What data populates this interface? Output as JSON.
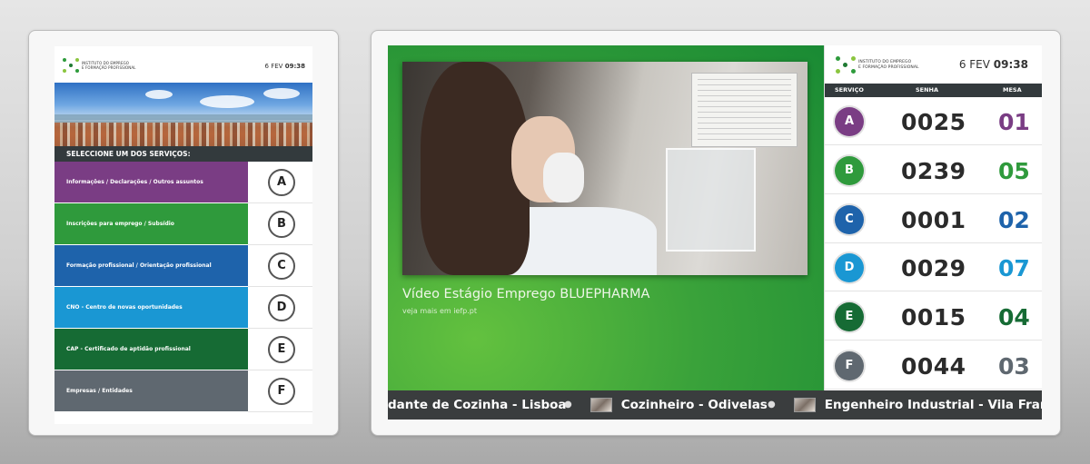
{
  "brand": {
    "logo_text": "Instituto do Emprego\ne Formação Profissional",
    "logo_colors": [
      "#2e9b3c",
      "#8bc53f",
      "#1f7a33"
    ]
  },
  "kiosk": {
    "date": "6 FEV",
    "time": "09:38",
    "prompt": "SELECCIONE UM DOS SERVIÇOS:",
    "services": [
      {
        "label": "Informações / Declarações / Outros assuntos",
        "letter": "A",
        "color": "#7a3d84"
      },
      {
        "label": "Inscrições para emprego / Subsídio",
        "letter": "B",
        "color": "#2f9a3c"
      },
      {
        "label": "Formação profissional / Orientação profissional",
        "letter": "C",
        "color": "#1e63ab"
      },
      {
        "label": "CNO - Centro de novas oportunidades",
        "letter": "D",
        "color": "#1a97d3"
      },
      {
        "label": "CAP - Certificado de aptidão profissional",
        "letter": "E",
        "color": "#166b34"
      },
      {
        "label": "Empresas / Entidades",
        "letter": "F",
        "color": "#5f6870"
      }
    ]
  },
  "display": {
    "video_title": "Vídeo Estágio Emprego BLUEPHARMA",
    "video_subtitle": "veja mais em iefp.pt",
    "date": "6 FEV",
    "time": "09:38",
    "columns": {
      "service": "SERVIÇO",
      "ticket": "SENHA",
      "desk": "MESA"
    },
    "queue": [
      {
        "service": "A",
        "ticket": "0025",
        "desk": "01",
        "color": "#7a3d84"
      },
      {
        "service": "B",
        "ticket": "0239",
        "desk": "05",
        "color": "#2f9a3c"
      },
      {
        "service": "C",
        "ticket": "0001",
        "desk": "02",
        "color": "#1e63ab"
      },
      {
        "service": "D",
        "ticket": "0029",
        "desk": "07",
        "color": "#1a97d3"
      },
      {
        "service": "E",
        "ticket": "0015",
        "desk": "04",
        "color": "#166b34"
      },
      {
        "service": "F",
        "ticket": "0044",
        "desk": "03",
        "color": "#5f6870"
      }
    ],
    "ticker": [
      "dante de Cozinha - Lisboa",
      "Cozinheiro - Odivelas",
      "Engenheiro Industrial - Vila Franca d"
    ]
  }
}
